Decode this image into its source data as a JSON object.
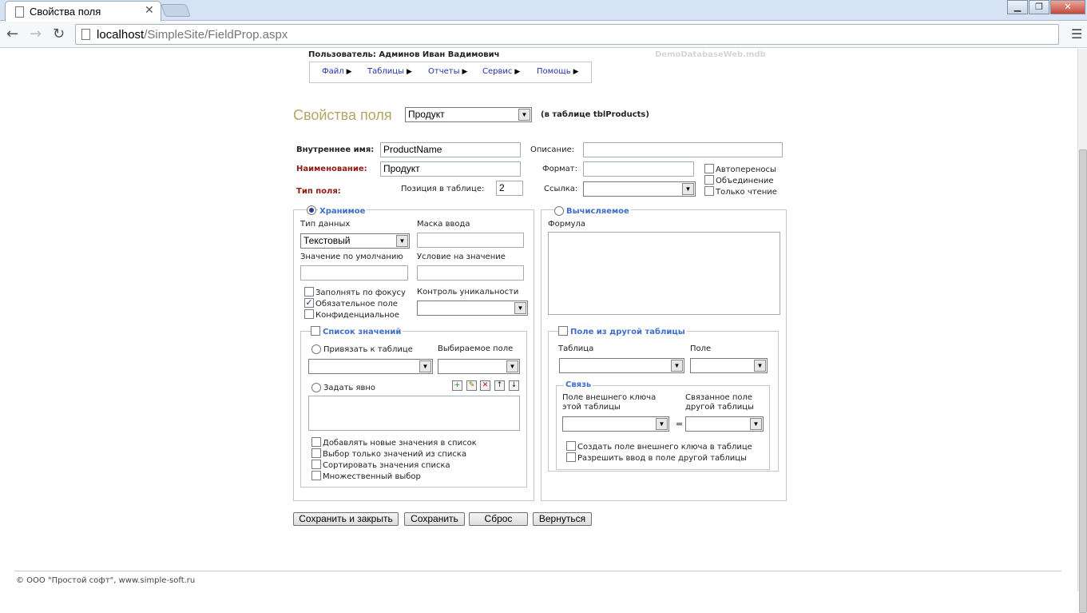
{
  "browser": {
    "tab_title": "Свойства поля",
    "url_host": "localhost",
    "url_path": "/SimpleSite/FieldProp.aspx",
    "window_controls": [
      "minimize",
      "maximize",
      "close"
    ]
  },
  "header": {
    "user_label": "Пользователь: Админов Иван Вадимович",
    "database": "DemoDatabaseWeb.mdb"
  },
  "menu": [
    "Файл",
    "Таблицы",
    "Отчеты",
    "Сервис",
    "Помощь"
  ],
  "title": {
    "text": "Свойства поля",
    "field_select": "Продукт",
    "table_note": "(в таблице tblProducts)"
  },
  "props": {
    "internal_name_label": "Внутреннее имя:",
    "internal_name_value": "ProductName",
    "caption_label": "Наименование:",
    "caption_value": "Продукт",
    "field_type_label": "Тип поля:",
    "position_label": "Позиция в таблице:",
    "position_value": "2",
    "description_label": "Описание:",
    "description_value": "",
    "format_label": "Формат:",
    "format_value": "",
    "link_label": "Ссылка:",
    "link_value": "",
    "autowrap_label": "Автопереносы",
    "merge_label": "Объединение",
    "readonly_label": "Только чтение"
  },
  "stored": {
    "legend": "Хранимое",
    "data_type_label": "Тип данных",
    "data_type_value": "Текстовый",
    "input_mask_label": "Маска ввода",
    "default_label": "Значение по умолчанию",
    "validation_label": "Условие на значение",
    "fill_focus_label": "Заполнять по фокусу",
    "required_label": "Обязательное поле",
    "confidential_label": "Конфиденциальное",
    "unique_label": "Контроль уникальности"
  },
  "value_list": {
    "legend": "Список значений",
    "bind_table_label": "Привязать к таблице",
    "select_field_label": "Выбираемое поле",
    "explicit_label": "Задать явно",
    "add_new_label": "Добавлять новые значения в список",
    "only_list_label": "Выбор только значений из списка",
    "sort_label": "Сортировать значения списка",
    "multi_label": "Множественный выбор"
  },
  "computed": {
    "legend": "Вычисляемое",
    "formula_label": "Формула"
  },
  "other_table": {
    "legend": "Поле из другой таблицы",
    "table_label": "Таблица",
    "field_label": "Поле",
    "link_legend": "Связь",
    "fk_label_1": "Поле внешнего ключа",
    "fk_label_2": "этой таблицы",
    "related_label_1": "Связанное поле",
    "related_label_2": "другой таблицы",
    "equals": "=",
    "create_fk_label": "Создать поле внешнего ключа в таблице",
    "allow_input_label": "Разрешить ввод в поле другой таблицы"
  },
  "buttons": {
    "save_close": "Сохранить и закрыть",
    "save": "Сохранить",
    "reset": "Сброс",
    "back": "Вернуться"
  },
  "footer": {
    "copyright": "© ООО \"Простой софт\", www.simple-soft.ru"
  }
}
